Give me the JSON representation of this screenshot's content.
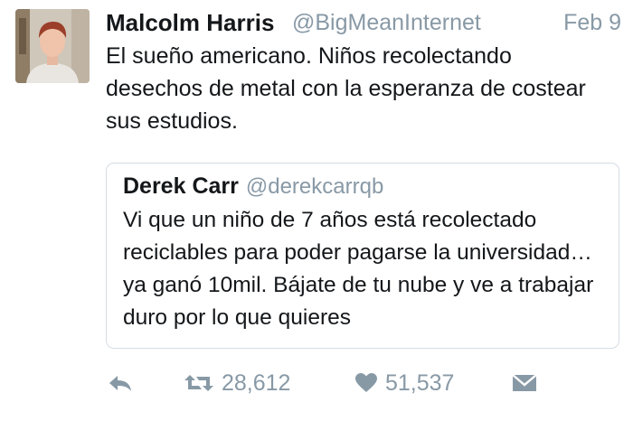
{
  "tweet": {
    "display_name": "Malcolm Harris",
    "handle": "@BigMeanInternet",
    "date": "Feb 9",
    "text": "El sueño americano. Niños recolectando desechos de metal con la esperanza de costear sus estudios."
  },
  "quoted_tweet": {
    "display_name": "Derek Carr",
    "handle": "@derekcarrqb",
    "text": "Vi que un niño de 7 años está recolectado reciclables para poder pagarse la universidad… ya ganó 10mil. Bájate de tu nube y ve a trabajar duro por lo que quieres"
  },
  "actions": {
    "reply_icon": "reply-icon",
    "retweet_icon": "retweet-icon",
    "retweet_count": "28,612",
    "like_icon": "heart-icon",
    "like_count": "51,537",
    "dm_icon": "envelope-icon"
  },
  "colors": {
    "text": "#14171a",
    "secondary": "#8899a6",
    "border": "#d5dce3",
    "background": "#ffffff"
  }
}
